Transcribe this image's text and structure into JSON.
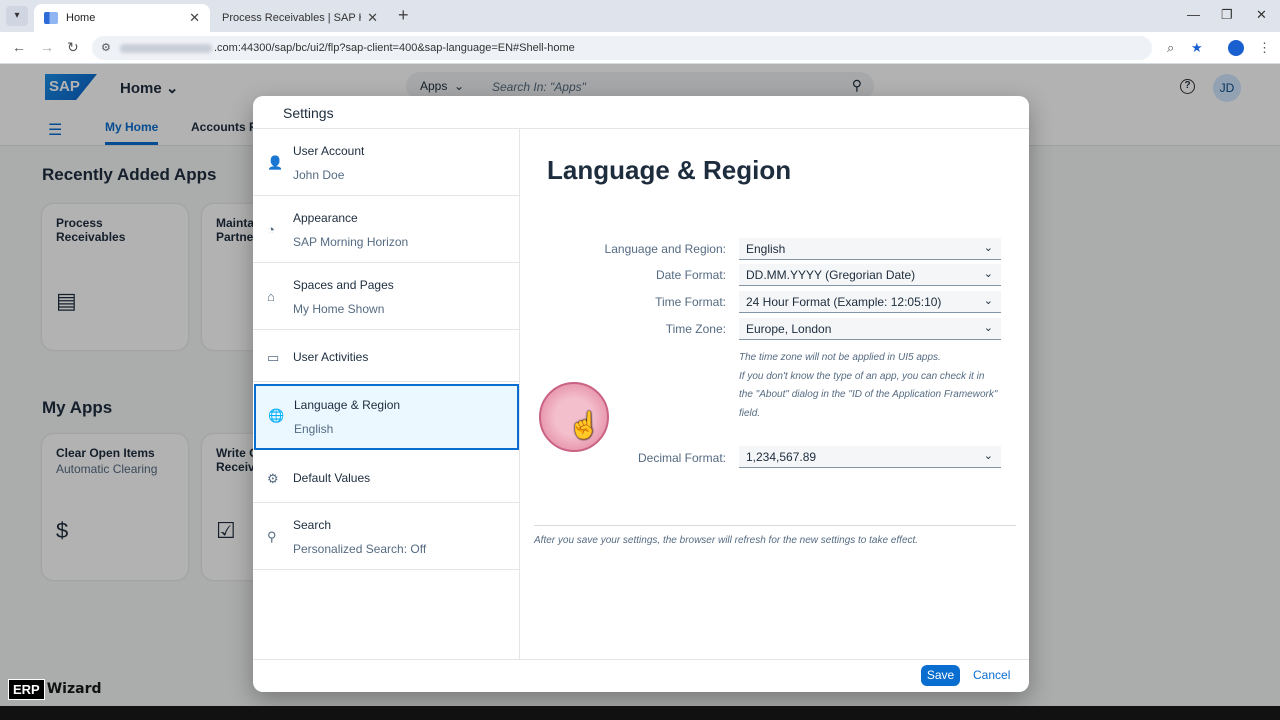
{
  "browser": {
    "tabs": [
      {
        "title": "Home",
        "active": true
      },
      {
        "title": "Process Receivables | SAP Help",
        "active": false
      }
    ],
    "url_visible": ".com:44300/sap/bc/ui2/flp?sap-client=400&sap-language=EN#Shell-home"
  },
  "shell": {
    "logo": "SAP",
    "title": "Home",
    "search_scope": "Apps",
    "search_placeholder": "Search In: \"Apps\"",
    "avatar": "JD",
    "tabs": [
      "My Home",
      "Accounts R"
    ]
  },
  "home": {
    "recent_title": "Recently Added Apps",
    "recent_tiles": [
      {
        "title": "Process Receivables",
        "subtitle": ""
      },
      {
        "title": "Mainta",
        "subtitle": "Partne"
      }
    ],
    "myapps_title": "My Apps",
    "myapps_tiles": [
      {
        "title": "Clear Open Items",
        "subtitle": "Automatic Clearing"
      },
      {
        "title": "Write O",
        "subtitle": "Receiv"
      }
    ]
  },
  "dialog": {
    "title": "Settings",
    "sidebar": [
      {
        "icon": "user-settings-icon",
        "title": "User Account",
        "subtitle": "John Doe"
      },
      {
        "icon": "palette-icon",
        "title": "Appearance",
        "subtitle": "SAP Morning Horizon"
      },
      {
        "icon": "home-icon",
        "title": "Spaces and Pages",
        "subtitle": "My Home Shown"
      },
      {
        "icon": "user-activities-icon",
        "title": "User Activities",
        "subtitle": ""
      },
      {
        "icon": "globe-icon",
        "title": "Language & Region",
        "subtitle": "English"
      },
      {
        "icon": "gear-icon",
        "title": "Default Values",
        "subtitle": ""
      },
      {
        "icon": "search-icon",
        "title": "Search",
        "subtitle": "Personalized Search: Off"
      }
    ],
    "heading": "Language & Region",
    "fields": {
      "language": {
        "label": "Language and Region:",
        "value": "English"
      },
      "date": {
        "label": "Date Format:",
        "value": "DD.MM.YYYY (Gregorian Date)"
      },
      "time": {
        "label": "Time Format:",
        "value": "24 Hour Format (Example: 12:05:10)"
      },
      "timezone": {
        "label": "Time Zone:",
        "value": "Europe, London"
      },
      "decimal": {
        "label": "Decimal Format:",
        "value": "1,234,567.89"
      }
    },
    "timezone_note": [
      "The time zone will not be applied in UI5 apps.",
      "If you don't know the type of an app, you can check it in",
      "the \"About\" dialog in the \"ID of the Application Framework\"",
      "field."
    ],
    "footnote": "After you save your settings, the browser will refresh for the new settings to take effect.",
    "save_label": "Save",
    "cancel_label": "Cancel"
  },
  "watermark": {
    "erp": "ERP",
    "wizard": "Wizard"
  }
}
